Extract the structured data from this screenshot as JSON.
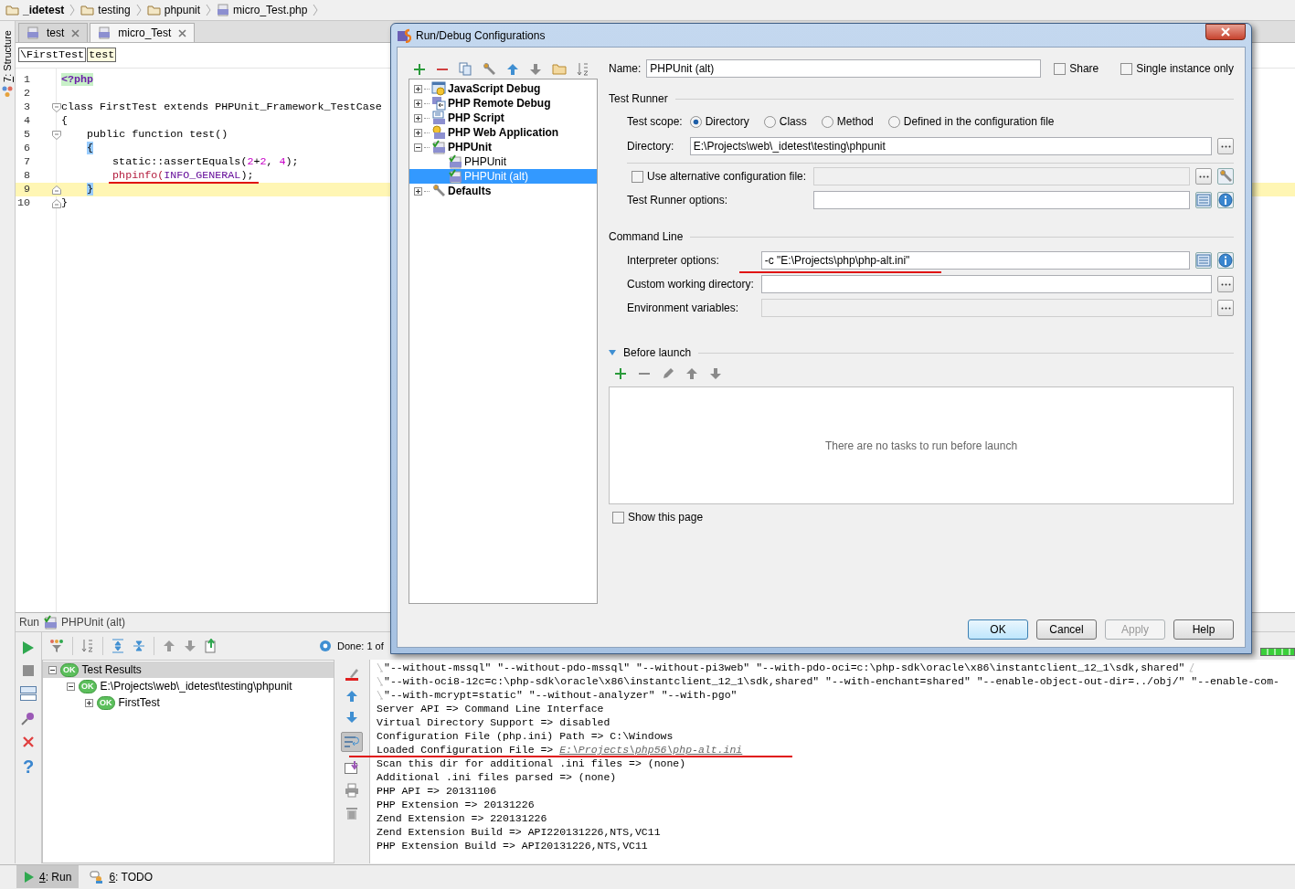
{
  "breadcrumbs": [
    {
      "label": "_idetest",
      "kind": "folder",
      "bold": true
    },
    {
      "label": "testing",
      "kind": "folder",
      "bold": false
    },
    {
      "label": "phpunit",
      "kind": "folder",
      "bold": false
    },
    {
      "label": "micro_Test.php",
      "kind": "php",
      "bold": false
    }
  ],
  "side_strip": {
    "mnemonic": "7",
    "label": ": Structure"
  },
  "editor": {
    "tabs": [
      {
        "label": "test",
        "selected": false
      },
      {
        "label": "micro_Test",
        "selected": true
      }
    ],
    "crumbs": [
      {
        "label": "\\FirstTest",
        "selected": false
      },
      {
        "label": "test",
        "selected": true
      }
    ],
    "code_lines": [
      {
        "number": "1",
        "highlighted": false,
        "underlined": false,
        "fold_start": false,
        "fold_end": false,
        "tokens": [
          {
            "text": "<?php",
            "kind": "tag"
          }
        ]
      },
      {
        "number": "2",
        "highlighted": false,
        "underlined": false,
        "fold_start": false,
        "fold_end": false
      },
      {
        "number": "3",
        "highlighted": false,
        "underlined": false,
        "fold_start": true,
        "fold_end": false,
        "tokens": [
          {
            "text": "class FirstTest extends PHPUnit_Framework_TestCase",
            "kind": "plain"
          }
        ]
      },
      {
        "number": "4",
        "highlighted": false,
        "underlined": false,
        "fold_start": false,
        "fold_end": false,
        "tokens": [
          {
            "text": "{",
            "kind": "plain"
          }
        ]
      },
      {
        "number": "5",
        "highlighted": false,
        "underlined": false,
        "fold_start": true,
        "fold_end": false,
        "tokens": [
          {
            "text": "    public function test()",
            "kind": "plain"
          }
        ]
      },
      {
        "number": "6",
        "highlighted": false,
        "underlined": false,
        "fold_start": false,
        "fold_end": false,
        "tokens": [
          {
            "text": "    {",
            "kind": "brace"
          }
        ]
      },
      {
        "number": "7",
        "highlighted": false,
        "underlined": false,
        "fold_start": false,
        "fold_end": false,
        "tokens": [
          {
            "text": "        static::assertEquals(",
            "kind": "plain"
          },
          {
            "text": "2",
            "kind": "number"
          },
          {
            "text": "+",
            "kind": "plain"
          },
          {
            "text": "2",
            "kind": "number"
          },
          {
            "text": ", ",
            "kind": "plain"
          },
          {
            "text": "4",
            "kind": "number"
          },
          {
            "text": ");",
            "kind": "plain"
          }
        ]
      },
      {
        "number": "8",
        "highlighted": false,
        "underlined": true,
        "fold_start": false,
        "fold_end": false,
        "tokens": [
          {
            "text": "        phpinfo(",
            "kind": "function"
          },
          {
            "text": "INFO_GENERAL",
            "kind": "constant"
          },
          {
            "text": ");",
            "kind": "plain"
          }
        ]
      },
      {
        "number": "9",
        "highlighted": true,
        "underlined": false,
        "fold_start": false,
        "fold_end": true,
        "tokens": [
          {
            "text": "    }",
            "kind": "brace"
          }
        ]
      },
      {
        "number": "10",
        "highlighted": false,
        "underlined": false,
        "fold_start": false,
        "fold_end": true,
        "tokens": [
          {
            "text": "}",
            "kind": "plain"
          }
        ]
      }
    ]
  },
  "run_panel": {
    "title": "Run",
    "config": "PHPUnit (alt)",
    "status": "Done: 1 of",
    "help": "?",
    "progress": {
      "level": 1
    },
    "tree": [
      {
        "label": "Test Results",
        "badge": "OK",
        "expanded": true,
        "selected": true,
        "children": [
          {
            "label": "E:\\Projects\\web\\_idetest\\testing\\phpunit",
            "badge": "OK",
            "expanded": true,
            "selected": false,
            "children": [
              {
                "label": "FirstTest",
                "badge": "OK",
                "expanded": false,
                "selected": false
              }
            ]
          }
        ]
      }
    ],
    "console": [
      {
        "wrapped": true,
        "continues": true,
        "underlined": false,
        "text": "\"--without-mssql\" \"--without-pdo-mssql\" \"--without-pi3web\" \"--with-pdo-oci=c:\\php-sdk\\oracle\\x86\\instantclient_12_1\\sdk,shared\""
      },
      {
        "wrapped": true,
        "continues": false,
        "underlined": false,
        "text": "\"--with-oci8-12c=c:\\php-sdk\\oracle\\x86\\instantclient_12_1\\sdk,shared\" \"--with-enchant=shared\" \"--enable-object-out-dir=../obj/\" \"--enable-com-"
      },
      {
        "wrapped": true,
        "continues": false,
        "underlined": false,
        "text": "\"--with-mcrypt=static\" \"--without-analyzer\" \"--with-pgo\""
      },
      {
        "wrapped": false,
        "continues": false,
        "underlined": false,
        "text": "Server API => Command Line Interface"
      },
      {
        "wrapped": false,
        "continues": false,
        "underlined": false,
        "text": "Virtual Directory Support => disabled"
      },
      {
        "wrapped": false,
        "continues": false,
        "underlined": false,
        "text": "Configuration File (php.ini) Path => C:\\Windows"
      },
      {
        "wrapped": false,
        "continues": false,
        "underlined": true,
        "text": "Loaded Configuration File => ",
        "link": "E:\\Projects\\php56\\php-alt.ini"
      },
      {
        "wrapped": false,
        "continues": false,
        "underlined": false,
        "text": "Scan this dir for additional .ini files => (none)"
      },
      {
        "wrapped": false,
        "continues": false,
        "underlined": false,
        "text": "Additional .ini files parsed => (none)"
      },
      {
        "wrapped": false,
        "continues": false,
        "underlined": false,
        "text": "PHP API => 20131106"
      },
      {
        "wrapped": false,
        "continues": false,
        "underlined": false,
        "text": "PHP Extension => 20131226"
      },
      {
        "wrapped": false,
        "continues": false,
        "underlined": false,
        "text": "Zend Extension => 220131226"
      },
      {
        "wrapped": false,
        "continues": false,
        "underlined": false,
        "text": "Zend Extension Build => API220131226,NTS,VC11"
      },
      {
        "wrapped": false,
        "continues": false,
        "underlined": false,
        "text": "PHP Extension Build => API20131226,NTS,VC11"
      }
    ]
  },
  "status_bar": {
    "buttons": [
      {
        "mnemonic": "4",
        "label": ": Run",
        "kind": "run",
        "selected": true
      },
      {
        "mnemonic": "6",
        "label": ": TODO",
        "kind": "todo",
        "selected": false
      }
    ]
  },
  "dialog": {
    "title": "Run/Debug Configurations",
    "tree": [
      {
        "label": "JavaScript Debug",
        "kind": "js",
        "expanded": false,
        "selected": false
      },
      {
        "label": "PHP Remote Debug",
        "kind": "remote",
        "expanded": false,
        "selected": false
      },
      {
        "label": "PHP Script",
        "kind": "php",
        "expanded": false,
        "selected": false
      },
      {
        "label": "PHP Web Application",
        "kind": "web",
        "expanded": false,
        "selected": false
      },
      {
        "label": "PHPUnit",
        "kind": "phpunit",
        "expanded": true,
        "selected": false,
        "children": [
          {
            "label": "PHPUnit",
            "kind": "phpunit",
            "selected": false
          },
          {
            "label": "PHPUnit (alt)",
            "kind": "phpunit",
            "selected": true
          }
        ]
      },
      {
        "label": "Defaults",
        "kind": "defaults",
        "expanded": false,
        "selected": false
      }
    ],
    "name": {
      "label": "Name:",
      "value": "PHPUnit (alt)"
    },
    "share": {
      "label": "Share",
      "checked": false
    },
    "single_instance": {
      "label": "Single instance only",
      "checked": false
    },
    "test_runner": {
      "title": "Test Runner",
      "scope_label": "Test scope:",
      "scopes": [
        {
          "label": "Directory",
          "selected": true
        },
        {
          "label": "Class",
          "selected": false
        },
        {
          "label": "Method",
          "selected": false
        },
        {
          "label": "Defined in the configuration file",
          "selected": false
        }
      ],
      "directory": {
        "label": "Directory:",
        "value": "E:\\Projects\\web\\_idetest\\testing\\phpunit"
      },
      "alt_config": {
        "label": "Use alternative configuration file:",
        "checked": false
      },
      "runner_options": {
        "label": "Test Runner options:"
      }
    },
    "command_line": {
      "title": "Command Line",
      "interpreter": {
        "label": "Interpreter options:",
        "value": "-c \"E:\\Projects\\php\\php-alt.ini\"",
        "underlined": true
      },
      "working_dir": {
        "label": "Custom working directory:"
      },
      "env_vars": {
        "label": "Environment variables:"
      }
    },
    "before_launch": {
      "title": "Before launch",
      "expanded": true,
      "empty_text": "There are no tasks to run before launch",
      "show_page": {
        "label": "Show this page",
        "checked": false
      }
    },
    "buttons": [
      {
        "label": "OK",
        "kind": "default",
        "disabled": false
      },
      {
        "label": "Cancel",
        "kind": "normal",
        "disabled": false
      },
      {
        "label": "Apply",
        "kind": "normal",
        "disabled": true
      },
      {
        "label": "Help",
        "kind": "normal",
        "disabled": false
      }
    ]
  }
}
